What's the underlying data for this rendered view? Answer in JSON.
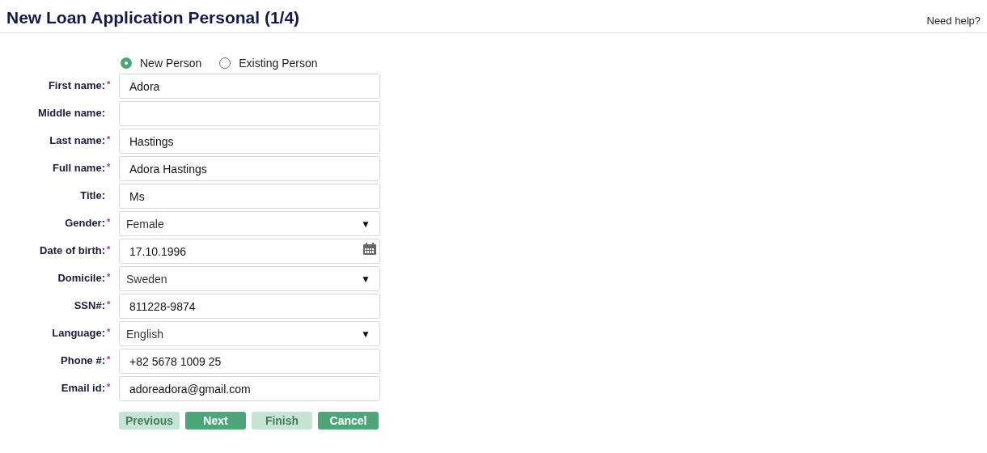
{
  "header": {
    "title": "New Loan Application Personal (1/4)",
    "help_link": "Need help?"
  },
  "person_type": [
    {
      "label": "New Person",
      "selected": true
    },
    {
      "label": "Existing Person",
      "selected": false
    }
  ],
  "fields": [
    {
      "label": "First name:",
      "required": true,
      "kind": "text",
      "value": "Adora"
    },
    {
      "label": "Middle name:",
      "required": false,
      "kind": "text"
    },
    {
      "label": "Last name:",
      "required": true,
      "kind": "text",
      "value": "Hastings"
    },
    {
      "label": "Full name:",
      "required": true,
      "kind": "text",
      "value": "Adora Hastings"
    },
    {
      "label": "Title:",
      "required": false,
      "kind": "text",
      "value": "Ms"
    },
    {
      "label": "Gender:",
      "required": true,
      "kind": "select",
      "value": "Female",
      "caret": "▼"
    },
    {
      "label": "Date of birth:",
      "required": true,
      "kind": "date",
      "value": "17.10.1996"
    },
    {
      "label": "Domicile:",
      "required": true,
      "kind": "select",
      "value": "Sweden",
      "caret": "▼"
    },
    {
      "label": "SSN#:",
      "required": true,
      "kind": "text",
      "value": "811228-9874"
    },
    {
      "label": "Language:",
      "required": true,
      "kind": "select",
      "value": "English",
      "caret": "▼"
    },
    {
      "label": "Phone #:",
      "required": true,
      "kind": "text",
      "value": "+82 5678 1009 25"
    },
    {
      "label": "Email id:",
      "required": true,
      "kind": "text",
      "value": "adoreadora@gmail.com"
    }
  ],
  "required_mark": "*",
  "buttons": [
    {
      "label": "Previous",
      "disabled": true
    },
    {
      "label": "Next",
      "disabled": false
    },
    {
      "label": "Finish",
      "disabled": true
    },
    {
      "label": "Cancel",
      "disabled": false
    }
  ]
}
